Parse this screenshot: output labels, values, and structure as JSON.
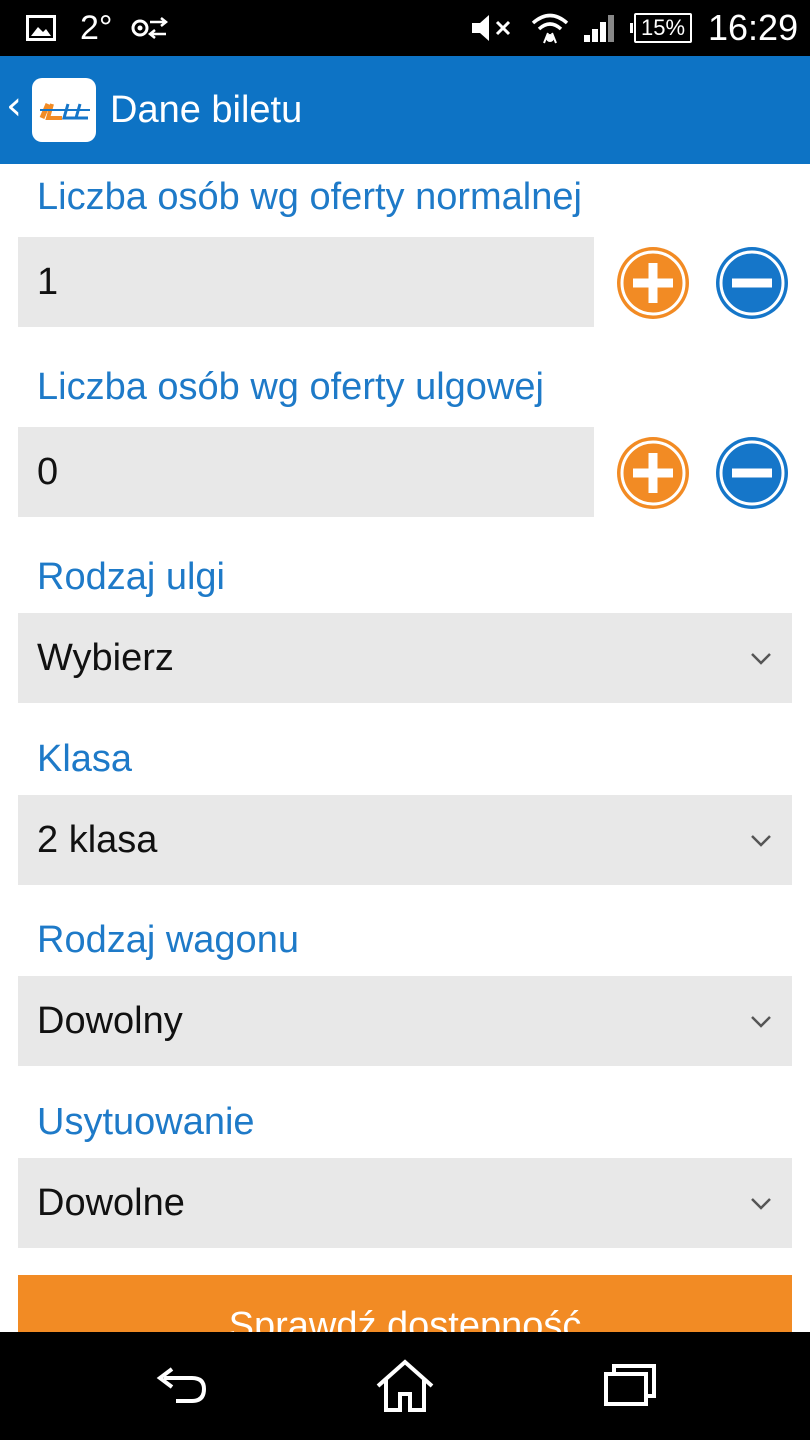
{
  "status_bar": {
    "temperature": "2°",
    "battery": "15%",
    "time": "16:29"
  },
  "action_bar": {
    "title": "Dane biletu"
  },
  "form": {
    "normal": {
      "label": "Liczba osób wg oferty normalnej",
      "value": "1"
    },
    "reduced": {
      "label": "Liczba osób wg oferty ulgowej",
      "value": "0"
    },
    "discount_type": {
      "label": "Rodzaj ulgi",
      "selected": "Wybierz"
    },
    "class": {
      "label": "Klasa",
      "selected": "2 klasa"
    },
    "carriage_type": {
      "label": "Rodzaj wagonu",
      "selected": "Dowolny"
    },
    "placement": {
      "label": "Usytuowanie",
      "selected": "Dowolne"
    }
  },
  "check_button": {
    "label": "Sprawdź dostępność"
  },
  "colors": {
    "accent_blue": "#0d73c5",
    "label_blue": "#1e7ac8",
    "plus_orange": "#f28b24",
    "minus_blue": "#1576c9"
  },
  "icons": {
    "nav": [
      "back-icon",
      "home-icon",
      "recent-apps-icon"
    ]
  }
}
